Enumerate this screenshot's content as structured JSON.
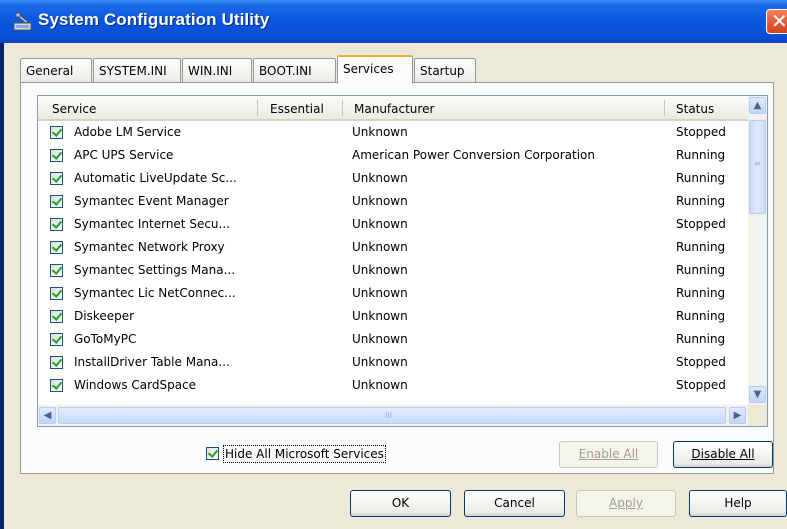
{
  "window": {
    "title": "System Configuration Utility",
    "close_glyph": "✕"
  },
  "tabs": [
    {
      "label": "General",
      "active": false
    },
    {
      "label": "SYSTEM.INI",
      "active": false
    },
    {
      "label": "WIN.INI",
      "active": false
    },
    {
      "label": "BOOT.INI",
      "active": false
    },
    {
      "label": "Services",
      "active": true
    },
    {
      "label": "Startup",
      "active": false
    }
  ],
  "list": {
    "columns": [
      "Service",
      "Essential",
      "Manufacturer",
      "Status"
    ],
    "rows": [
      {
        "checked": true,
        "service": "Adobe LM Service",
        "essential": "",
        "manufacturer": "Unknown",
        "status": "Stopped"
      },
      {
        "checked": true,
        "service": "APC UPS Service",
        "essential": "",
        "manufacturer": "American Power Conversion Corporation",
        "status": "Running"
      },
      {
        "checked": true,
        "service": "Automatic LiveUpdate Sc...",
        "essential": "",
        "manufacturer": "Unknown",
        "status": "Running"
      },
      {
        "checked": true,
        "service": "Symantec Event Manager",
        "essential": "",
        "manufacturer": "Unknown",
        "status": "Running"
      },
      {
        "checked": true,
        "service": "Symantec Internet Secu...",
        "essential": "",
        "manufacturer": "Unknown",
        "status": "Stopped"
      },
      {
        "checked": true,
        "service": "Symantec Network Proxy",
        "essential": "",
        "manufacturer": "Unknown",
        "status": "Running"
      },
      {
        "checked": true,
        "service": "Symantec Settings Mana...",
        "essential": "",
        "manufacturer": "Unknown",
        "status": "Running"
      },
      {
        "checked": true,
        "service": "Symantec Lic NetConnec...",
        "essential": "",
        "manufacturer": "Unknown",
        "status": "Running"
      },
      {
        "checked": true,
        "service": "Diskeeper",
        "essential": "",
        "manufacturer": "Unknown",
        "status": "Running"
      },
      {
        "checked": true,
        "service": "GoToMyPC",
        "essential": "",
        "manufacturer": "Unknown",
        "status": "Running"
      },
      {
        "checked": true,
        "service": "InstallDriver Table Mana...",
        "essential": "",
        "manufacturer": "Unknown",
        "status": "Stopped"
      },
      {
        "checked": true,
        "service": "Windows CardSpace",
        "essential": "",
        "manufacturer": "Unknown",
        "status": "Stopped"
      }
    ]
  },
  "scrollbar": {
    "up": "▲",
    "down": "▼",
    "left": "◀",
    "right": "▶",
    "grip_v": "≡",
    "grip_h": "III"
  },
  "options": {
    "hide_ms_label": "Hide All Microsoft Services",
    "hide_ms_checked": true
  },
  "buttons": {
    "enable_all": "Enable All",
    "disable_all": "Disable All",
    "ok": "OK",
    "cancel": "Cancel",
    "apply": "Apply",
    "help": "Help"
  }
}
